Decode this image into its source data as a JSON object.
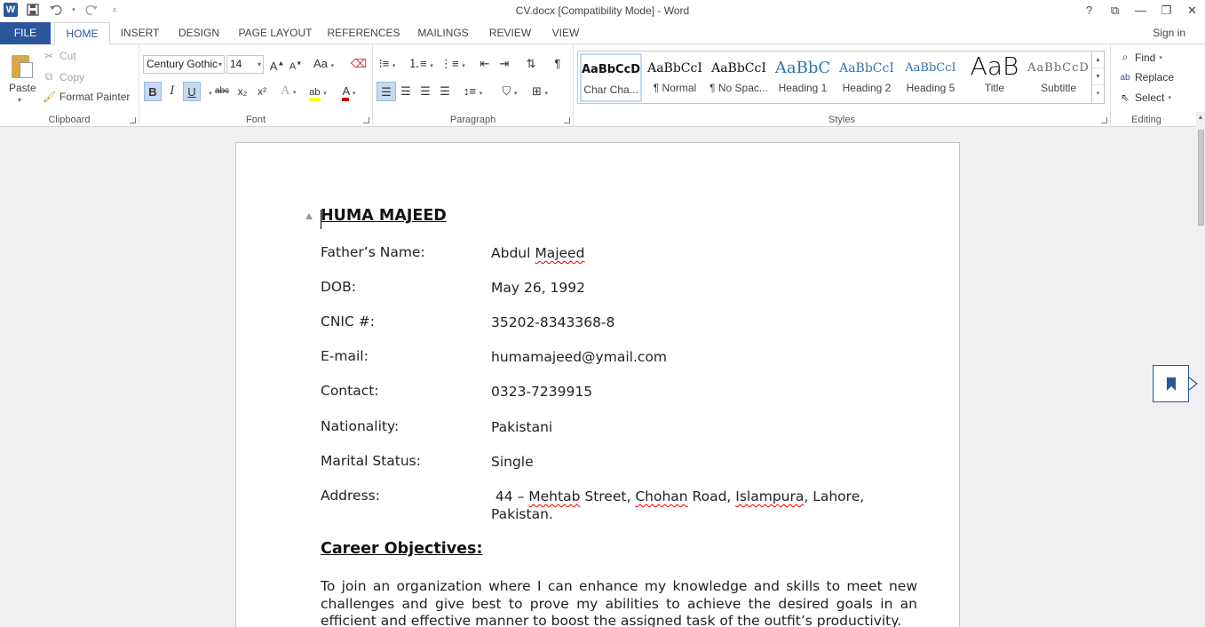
{
  "window": {
    "title": "CV.docx [Compatibility Mode] - Word",
    "help": "?",
    "controls": [
      "⧉",
      "—",
      "❐",
      "✕"
    ]
  },
  "qat": {
    "logo": "W",
    "save_icon": "save-icon",
    "undo_icon": "undo-icon",
    "redo_icon": "redo-icon",
    "customize_icon": "customize-icon"
  },
  "tabs": [
    "FILE",
    "HOME",
    "INSERT",
    "DESIGN",
    "PAGE LAYOUT",
    "REFERENCES",
    "MAILINGS",
    "REVIEW",
    "VIEW"
  ],
  "active_tab": "HOME",
  "signin": "Sign in",
  "clipboard": {
    "paste": "Paste",
    "cut": "Cut",
    "copy": "Copy",
    "format_painter": "Format Painter",
    "label": "Clipboard"
  },
  "font": {
    "name": "Century Gothic",
    "size": "14",
    "label": "Font",
    "bold": "B",
    "italic": "I",
    "underline": "U",
    "strike": "abc",
    "sub": "x₂",
    "sup": "x²",
    "grow": "A^",
    "shrink": "Aˇ",
    "case": "Aa",
    "effects": "A",
    "highlight": "ab",
    "color": "A"
  },
  "paragraph": {
    "label": "Paragraph",
    "pilcrow": "¶"
  },
  "styles": {
    "label": "Styles",
    "items": [
      {
        "sample": "AaBbCcD",
        "name": "Char Cha..."
      },
      {
        "sample": "AaBbCcI",
        "name": "¶ Normal"
      },
      {
        "sample": "AaBbCcI",
        "name": "¶ No Spac..."
      },
      {
        "sample": "AaBbC",
        "name": "Heading 1"
      },
      {
        "sample": "AaBbCcI",
        "name": "Heading 2"
      },
      {
        "sample": "AaBbCcI",
        "name": "Heading 5"
      },
      {
        "sample": "AaB",
        "name": "Title"
      },
      {
        "sample": "AaBbCcD",
        "name": "Subtitle"
      }
    ]
  },
  "editing": {
    "label": "Editing",
    "find": "Find",
    "replace": "Replace",
    "select": "Select"
  },
  "document": {
    "name": "HUMA MAJEED",
    "fields": [
      {
        "label": "Father’s Name:",
        "value": "Abdul Majeed"
      },
      {
        "label": "DOB:",
        "value": "May 26, 1992"
      },
      {
        "label": "CNIC #:",
        "value": "35202-8343368-8"
      },
      {
        "label": "E-mail:",
        "value": "humamajeed@ymail.com"
      },
      {
        "label": "Contact:",
        "value": "0323-7239915"
      },
      {
        "label": "Nationality:",
        "value": "Pakistani"
      },
      {
        "label": "Marital Status:",
        "value": "Single"
      },
      {
        "label": "Address:",
        "value": " 44 – Mehtab Street, Chohan Road, Islampura, Lahore, Pakistan."
      }
    ],
    "section_heading": "Career Objectives:",
    "objective": "To join an organization where I can enhance my knowledge and skills to meet new challenges and give best to prove my abilities to achieve the desired goals in an efficient and effective manner to boost the assigned task of the outfit’s productivity."
  },
  "colors": {
    "accent": "#2b579a",
    "workspace": "#f0f0f0",
    "pressed": "#c5d9f1"
  }
}
